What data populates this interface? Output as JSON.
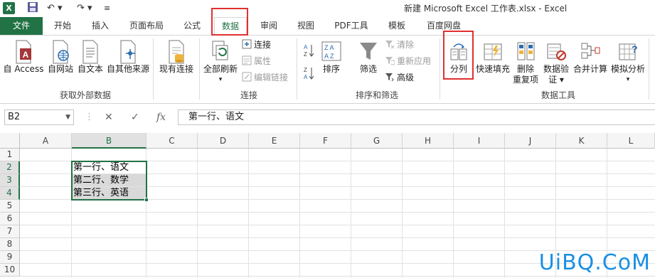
{
  "titlebar": {
    "app_logo": "X",
    "save_icon": "save-icon",
    "undo_glyph": "↶ ▾",
    "redo_glyph": "↷ ▾",
    "customize_glyph": "≡",
    "title": "新建 Microsoft Excel 工作表.xlsx - Excel"
  },
  "tabs": [
    "文件",
    "开始",
    "插入",
    "页面布局",
    "公式",
    "数据",
    "审阅",
    "视图",
    "PDF工具",
    "模板",
    "百度网盘"
  ],
  "active_tab": "数据",
  "ribbon": {
    "external": {
      "group_label": "获取外部数据",
      "buttons": [
        "自 Access",
        "自网站",
        "自文本",
        "自其他来源"
      ]
    },
    "existing": {
      "label": "现有连接"
    },
    "connections": {
      "group_label": "连接",
      "refresh_label": "全部刷新",
      "small": [
        {
          "label": "连接",
          "enabled": true
        },
        {
          "label": "属性",
          "enabled": false
        },
        {
          "label": "编辑链接",
          "enabled": false
        }
      ]
    },
    "sort_filter": {
      "group_label": "排序和筛选",
      "sort_label": "排序",
      "filter_label": "筛选",
      "small": [
        {
          "label": "清除",
          "enabled": false
        },
        {
          "label": "重新应用",
          "enabled": false
        },
        {
          "label": "高级",
          "enabled": true
        }
      ]
    },
    "data_tools": {
      "group_label": "数据工具",
      "split_label": "分列",
      "flash_fill_label": "快速填充",
      "remove_dup_label": [
        "删除",
        "重复项"
      ],
      "validation_label": [
        "数据验",
        "证 ▾"
      ],
      "consolidate_label": "合并计算",
      "whatif_label": [
        "模拟分析",
        "▾"
      ]
    }
  },
  "formula_bar": {
    "name_box": "B2",
    "fx": "fx",
    "content": "第一行、语文"
  },
  "sheet": {
    "columns": [
      "A",
      "B",
      "C",
      "D",
      "E",
      "F",
      "G",
      "H",
      "I",
      "J",
      "K",
      "L"
    ],
    "rows": [
      "1",
      "2",
      "3",
      "4",
      "5",
      "6",
      "7",
      "8",
      "9",
      "10"
    ],
    "selected_column": "B",
    "cells": {
      "B2": "第一行、语文",
      "B3": "第二行、数学",
      "B4": "第三行、英语"
    }
  },
  "watermark": "UiBQ.CoM",
  "colors": {
    "excel_green": "#217346",
    "highlight_red": "#e03030"
  }
}
